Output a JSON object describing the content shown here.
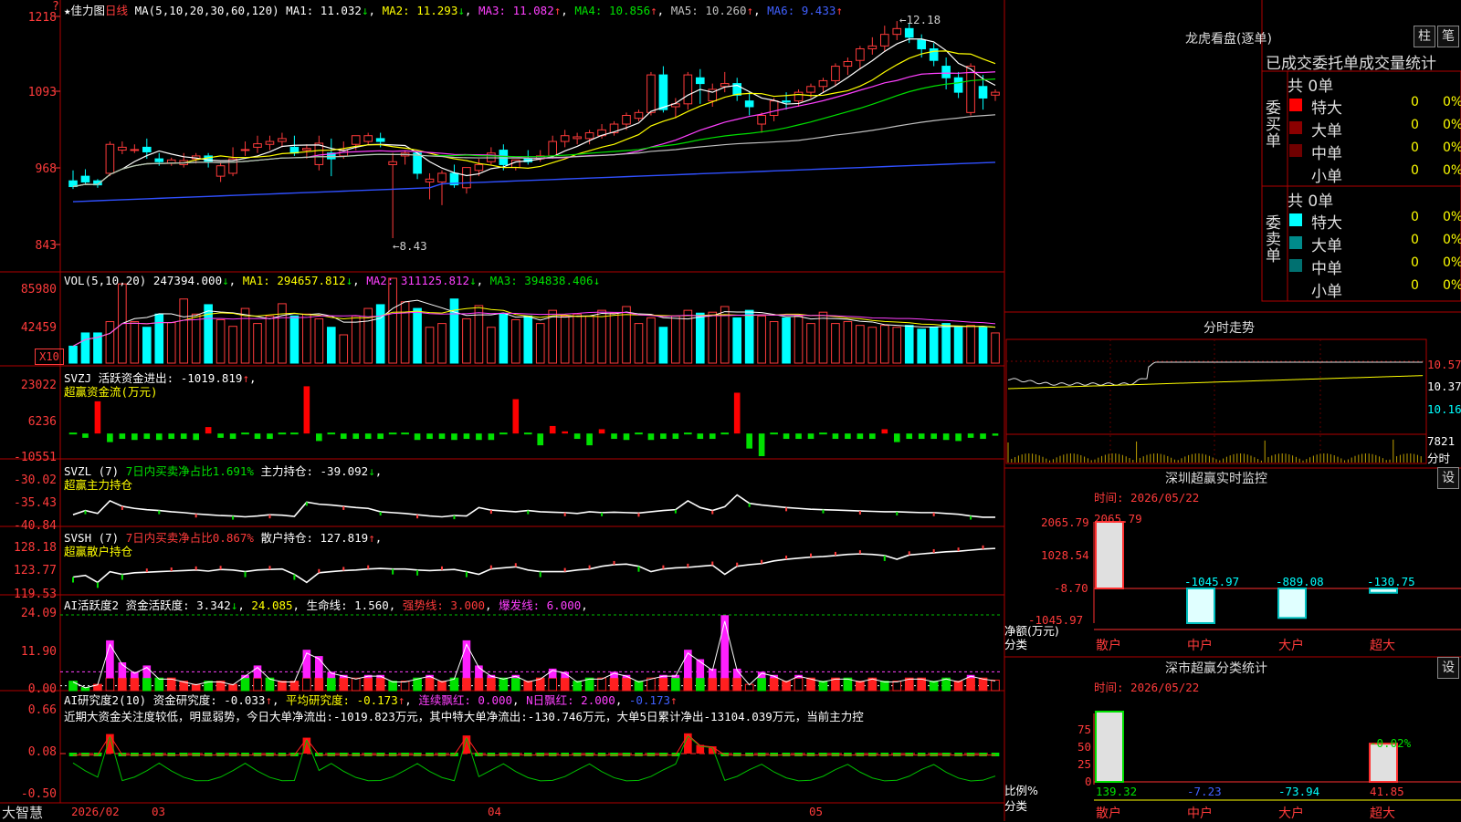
{
  "app": {
    "brand": "大智慧",
    "star": "★",
    "stock_name": "佳力图",
    "period": "日线",
    "corner": "?"
  },
  "main_header": {
    "ma_label": "MA(5,10,20,30,60,120)",
    "ma1": "MA1: 11.032",
    "ma1_arrow": "↓",
    "ma2": "MA2: 11.293",
    "ma2_arrow": "↓",
    "ma3": "MA3: 11.082",
    "ma3_arrow": "↑",
    "ma4": "MA4: 10.856",
    "ma4_arrow": "↑",
    "ma5": "MA5: 10.260",
    "ma5_arrow": "↑",
    "ma6": "MA6: 9.433",
    "ma6_arrow": "↑",
    "high_marker": "12.18",
    "low_marker": "8.43"
  },
  "vol_header": {
    "label": "VOL(5,10,20)",
    "value": "247394.000",
    "arrow": "↓",
    "ma1": "MA1: 294657.812",
    "ma1_arrow": "↓",
    "ma2": "MA2: 311125.812",
    "ma2_arrow": "↓",
    "ma3": "MA3: 394838.406",
    "ma3_arrow": "↓",
    "unit": "X10"
  },
  "svzj_header": {
    "label": "SVZJ",
    "text": "活跃资金进出: -1019.819",
    "arrow": "↑",
    "tail": ",",
    "sub": "超赢资金流(万元)"
  },
  "svzl_header": {
    "label": "SVZL (7)",
    "text1": "7日内买卖净占比1.691%",
    "text2": "主力持仓: -39.092",
    "arrow": "↓",
    "tail": ",",
    "sub": "超赢主力持仓"
  },
  "svsh_header": {
    "label": "SVSH (7)",
    "text1": "7日内买卖净占比0.867%",
    "text2": "散户持仓: 127.819",
    "arrow": "↑",
    "tail": ",",
    "sub": "超赢散户持仓"
  },
  "ai_active_header": {
    "label": "AI活跃度2",
    "text": "资金活跃度: 3.342",
    "arrow": "↓",
    "val2": "24.085",
    "life": "生命线: 1.560",
    "strong": "强势线: 3.000",
    "burst": "爆发线: 6.000"
  },
  "ai_research_header": {
    "label": "AI研究度2(10)",
    "text": "资金研究度: -0.033",
    "arrow": "↑",
    "avg": "平均研究度: -0.173",
    "avg_arrow": "↑",
    "red": "连续飘红: 0.000",
    "nred": "N日飘红: 2.000",
    "last": "-0.173",
    "last_arrow": "↑",
    "comment": "近期大资金关注度较低，明显弱势，今日大单净流出:-1019.823万元，其中特大单净流出:-130.746万元，大单5日累计净出-13104.039万元，当前主力控"
  },
  "y_labels": {
    "main": [
      "1218",
      "1093",
      "968",
      "843"
    ],
    "vol": [
      "85980",
      "42459"
    ],
    "svzj": [
      "23022",
      "6236",
      "-10551"
    ],
    "svzl": [
      "-30.02",
      "-35.43",
      "-40.84"
    ],
    "svsh": [
      "128.18",
      "123.77",
      "119.53"
    ],
    "ai_active": [
      "24.09",
      "11.90",
      "0.00"
    ],
    "ai_research": [
      "0.66",
      "0.08",
      "-0.50"
    ]
  },
  "x_axis": [
    "2026/02",
    "03",
    "04",
    "05"
  ],
  "right": {
    "dragon_title": "龙虎看盘(逐单)",
    "btn1": "柱",
    "btn2": "笔",
    "table_title": "已成交委托单成交量统计",
    "buy_side": "委买单",
    "sell_side": "委卖单",
    "buy_total": "共 0单",
    "sell_total": "共 0单",
    "buy_rows": [
      {
        "name": "特大",
        "count": "0",
        "pct": "0%",
        "color": "#ff0000"
      },
      {
        "name": "大单",
        "count": "0",
        "pct": "0%",
        "color": "#8b0000"
      },
      {
        "name": "中单",
        "count": "0",
        "pct": "0%",
        "color": "#700000"
      },
      {
        "name": "小单",
        "count": "0",
        "pct": "0%",
        "color": "#000000"
      }
    ],
    "sell_rows": [
      {
        "name": "特大",
        "count": "0",
        "pct": "0%",
        "color": "#00ffff"
      },
      {
        "name": "大单",
        "count": "0",
        "pct": "0%",
        "color": "#008b8b"
      },
      {
        "name": "中单",
        "count": "0",
        "pct": "0%",
        "color": "#007070"
      },
      {
        "name": "小单",
        "count": "0",
        "pct": "0%",
        "color": "#000000"
      }
    ],
    "intraday_title": "分时走势",
    "intraday_labels": [
      "10.57",
      "10.37",
      "10.16"
    ],
    "intraday_vol": "7821",
    "intraday_unit": "分时",
    "sz_title": "深圳超赢实时监控",
    "sz_btn": "设",
    "sz_time": "时间: 2026/05/22",
    "sz_y": [
      "2065.79",
      "1028.54",
      "-8.70",
      "-1045.97"
    ],
    "sz_unit1": "净额(万元)",
    "sz_unit2": "分类",
    "sz_cats": [
      "散户",
      "中户",
      "大户",
      "超大"
    ],
    "sz_vals": [
      "2065.79",
      "-1045.97",
      "-889.08",
      "-130.75"
    ],
    "sc_title": "深市超赢分类统计",
    "sc_btn": "设",
    "sc_time": "时间: 2026/05/22",
    "sc_y": [
      "75",
      "50",
      "25",
      "0"
    ],
    "sc_unit1": "比例%",
    "sc_unit2": "分类",
    "sc_cats": [
      "散户",
      "中户",
      "大户",
      "超大"
    ],
    "sc_vals": [
      "139.32",
      "-7.23",
      "-73.94",
      "41.85"
    ],
    "sc_top": "-0.02%"
  },
  "chart_data": [
    {
      "type": "candlestick",
      "title": "佳力图 日线",
      "ylim": [
        8.2,
        12.4
      ],
      "candles": [
        [
          9.42,
          9.6,
          9.32,
          9.28
        ],
        [
          9.5,
          9.62,
          9.4,
          9.35
        ],
        [
          9.42,
          9.45,
          9.35,
          9.3
        ],
        [
          9.55,
          10.1,
          10.05,
          9.5
        ],
        [
          9.95,
          10.1,
          10.0,
          9.88
        ],
        [
          9.95,
          10.05,
          9.96,
          9.9
        ],
        [
          10.0,
          10.15,
          9.92,
          9.8
        ],
        [
          9.8,
          9.9,
          9.75,
          9.68
        ],
        [
          9.72,
          9.82,
          9.78,
          9.68
        ],
        [
          9.7,
          9.9,
          9.77,
          9.65
        ],
        [
          9.8,
          9.9,
          9.85,
          9.72
        ],
        [
          9.85,
          9.9,
          9.75,
          9.65
        ],
        [
          9.5,
          9.75,
          9.68,
          9.4
        ],
        [
          9.55,
          10.0,
          9.8,
          9.5
        ],
        [
          9.95,
          10.1,
          9.96,
          9.85
        ],
        [
          10.0,
          10.2,
          10.06,
          9.9
        ],
        [
          10.05,
          10.2,
          10.1,
          9.95
        ],
        [
          10.1,
          10.25,
          10.15,
          10.0
        ],
        [
          10.0,
          10.2,
          9.9,
          9.85
        ],
        [
          9.95,
          10.05,
          9.98,
          9.8
        ],
        [
          9.7,
          10.2,
          10.07,
          9.6
        ],
        [
          9.9,
          10.15,
          9.8,
          9.5
        ],
        [
          9.85,
          10.1,
          9.95,
          9.8
        ],
        [
          10.05,
          10.2,
          10.2,
          9.95
        ],
        [
          10.1,
          10.25,
          10.2,
          10.05
        ],
        [
          10.15,
          10.25,
          10.1,
          10.0
        ],
        [
          9.7,
          9.9,
          9.75,
          8.43
        ],
        [
          9.85,
          9.95,
          9.9,
          9.7
        ],
        [
          9.9,
          9.92,
          9.55,
          9.45
        ],
        [
          9.4,
          9.55,
          9.45,
          9.1
        ],
        [
          9.4,
          9.6,
          9.55,
          9.0
        ],
        [
          9.55,
          9.7,
          9.35,
          9.3
        ],
        [
          9.3,
          9.5,
          9.65,
          9.2
        ],
        [
          9.6,
          9.8,
          9.7,
          9.5
        ],
        [
          9.75,
          10.0,
          9.9,
          9.7
        ],
        [
          9.95,
          10.05,
          9.7,
          9.6
        ],
        [
          9.65,
          9.75,
          9.78,
          9.6
        ],
        [
          9.8,
          9.95,
          9.75,
          9.7
        ],
        [
          9.8,
          9.95,
          9.85,
          9.75
        ],
        [
          9.85,
          10.2,
          10.1,
          9.8
        ],
        [
          10.1,
          10.3,
          10.2,
          10.0
        ],
        [
          10.15,
          10.25,
          10.18,
          10.05
        ],
        [
          10.15,
          10.3,
          10.25,
          10.05
        ],
        [
          10.2,
          10.4,
          10.3,
          10.15
        ],
        [
          10.25,
          10.45,
          10.4,
          10.2
        ],
        [
          10.4,
          10.6,
          10.55,
          10.3
        ],
        [
          10.5,
          10.65,
          10.6,
          10.45
        ],
        [
          10.6,
          11.3,
          11.25,
          10.55
        ],
        [
          11.25,
          11.4,
          10.65,
          10.6
        ],
        [
          10.7,
          10.85,
          10.75,
          10.5
        ],
        [
          10.75,
          11.3,
          11.25,
          10.65
        ],
        [
          11.2,
          11.35,
          11.1,
          10.75
        ],
        [
          10.8,
          11.1,
          11.0,
          10.7
        ],
        [
          11.05,
          11.3,
          11.1,
          10.95
        ],
        [
          11.1,
          11.2,
          10.9,
          10.8
        ],
        [
          10.8,
          10.95,
          10.7,
          10.55
        ],
        [
          10.4,
          10.6,
          10.55,
          10.25
        ],
        [
          10.55,
          10.85,
          10.8,
          10.45
        ],
        [
          10.8,
          10.95,
          10.78,
          10.65
        ],
        [
          10.8,
          11.0,
          10.95,
          10.7
        ],
        [
          10.95,
          11.1,
          11.05,
          10.85
        ],
        [
          11.05,
          11.2,
          11.15,
          10.95
        ],
        [
          11.15,
          11.45,
          11.4,
          11.05
        ],
        [
          11.4,
          11.55,
          11.48,
          11.25
        ],
        [
          11.5,
          11.75,
          11.7,
          11.35
        ],
        [
          11.7,
          11.9,
          11.75,
          11.6
        ],
        [
          11.75,
          12.1,
          11.95,
          11.65
        ],
        [
          11.95,
          12.18,
          12.05,
          11.85
        ],
        [
          12.05,
          12.15,
          11.9,
          11.8
        ],
        [
          11.85,
          11.95,
          11.7,
          11.55
        ],
        [
          11.7,
          11.8,
          11.5,
          11.4
        ],
        [
          11.4,
          11.55,
          11.2,
          11.0
        ],
        [
          11.2,
          11.3,
          10.95,
          10.85
        ],
        [
          10.6,
          11.45,
          11.4,
          10.55
        ],
        [
          11.05,
          11.25,
          10.85,
          10.65
        ],
        [
          10.9,
          11.0,
          10.95,
          10.8
        ]
      ]
    },
    {
      "type": "bar",
      "title": "VOL(5,10,20)",
      "ylim": [
        0,
        90000
      ],
      "values": [
        18000,
        32000,
        32000,
        44000,
        84000,
        44000,
        38000,
        52000,
        43000,
        68000,
        52000,
        62000,
        46000,
        39000,
        58000,
        42000,
        50000,
        63000,
        50000,
        52000,
        47000,
        38000,
        30000,
        50000,
        58000,
        62000,
        90000,
        65000,
        58000,
        38000,
        42000,
        68000,
        47000,
        61000,
        38000,
        52000,
        46000,
        50000,
        42000,
        56000,
        50000,
        52000,
        50000,
        56000,
        53000,
        60000,
        42000,
        48000,
        38000,
        50000,
        56000,
        53000,
        54000,
        60000,
        48000,
        56000,
        50000,
        44000,
        48000,
        50000,
        42000,
        54000,
        42000,
        44000,
        40000,
        38000,
        40000,
        38000,
        40000,
        36000,
        38000,
        42000,
        38000,
        40000,
        38000,
        32000
      ],
      "up_color": "#ff3b3b",
      "down_color": "#00ffff"
    },
    {
      "type": "bar",
      "title": "SVZJ 活跃资金进出 (万元)",
      "ylim": [
        -10551,
        23022
      ],
      "values": [
        0,
        -2000,
        15000,
        -4000,
        -2500,
        -3000,
        -2500,
        -3000,
        -2500,
        -2500,
        -3000,
        3000,
        -2000,
        -2500,
        0,
        -2500,
        -2500,
        0,
        0,
        22000,
        -3500,
        0,
        -2500,
        -2500,
        -2500,
        -2500,
        0,
        0,
        -3000,
        -2500,
        -2500,
        -3000,
        -2500,
        -3000,
        -3000,
        0,
        16000,
        0,
        -5500,
        3500,
        1000,
        -2500,
        -5500,
        2000,
        -2500,
        -3000,
        0,
        -3000,
        -2500,
        -2500,
        0,
        -2500,
        -2500,
        0,
        19000,
        -7000,
        -10551,
        0,
        -2500,
        -2500,
        -2500,
        0,
        -2500,
        -2500,
        -2500,
        -2500,
        2000,
        -4000,
        -2500,
        -2500,
        -2500,
        -3000,
        -3500,
        -2000,
        -2500,
        -1019.819
      ]
    },
    {
      "type": "line",
      "title": "SVZL 主力持仓",
      "ylim": [
        -40.84,
        -30.02
      ],
      "values": [
        -38.5,
        -37.5,
        -38.2,
        -35.2,
        -36.5,
        -37.0,
        -37.3,
        -37.5,
        -37.8,
        -38.0,
        -38.3,
        -38.5,
        -38.7,
        -38.8,
        -39.0,
        -38.8,
        -38.5,
        -38.6,
        -38.9,
        -35.5,
        -36.0,
        -36.2,
        -36.5,
        -36.8,
        -37.0,
        -37.8,
        -38.0,
        -38.2,
        -38.5,
        -38.8,
        -39.0,
        -38.7,
        -38.8,
        -36.8,
        -37.4,
        -37.6,
        -37.8,
        -37.5,
        -37.8,
        -37.9,
        -38.0,
        -38.2,
        -37.8,
        -38.0,
        -37.9,
        -38.0,
        -38.1,
        -37.8,
        -37.5,
        -37.3,
        -35.2,
        -36.8,
        -37.5,
        -36.6,
        -33.8,
        -35.8,
        -36.2,
        -36.5,
        -36.8,
        -37.0,
        -37.2,
        -37.3,
        -37.4,
        -37.5,
        -37.6,
        -37.7,
        -37.8,
        -37.8,
        -37.9,
        -38.0,
        -38.0,
        -38.2,
        -38.4,
        -38.8,
        -39.1,
        -39.09
      ]
    },
    {
      "type": "line",
      "title": "SVSH 散户持仓",
      "ylim": [
        119.53,
        128.18
      ],
      "values": [
        122.5,
        122.8,
        121.5,
        123.5,
        123.0,
        123.3,
        123.4,
        123.5,
        123.6,
        123.7,
        123.8,
        123.6,
        123.9,
        123.8,
        123.5,
        123.8,
        123.9,
        124.0,
        123.0,
        121.5,
        123.3,
        123.5,
        123.7,
        123.8,
        124.0,
        124.1,
        124.0,
        124.0,
        123.8,
        123.7,
        123.8,
        123.9,
        123.5,
        123.0,
        124.0,
        124.2,
        124.4,
        123.8,
        123.5,
        123.5,
        123.5,
        123.8,
        124.0,
        124.5,
        124.8,
        124.9,
        124.5,
        123.5,
        124.0,
        124.2,
        124.3,
        124.5,
        124.7,
        123.0,
        124.5,
        124.8,
        125.0,
        125.5,
        125.8,
        126.0,
        126.2,
        126.3,
        126.5,
        126.7,
        126.8,
        126.7,
        126.5,
        125.8,
        126.6,
        126.8,
        127.0,
        127.2,
        127.3,
        127.5,
        127.7,
        127.82
      ]
    },
    {
      "type": "bar",
      "title": "AI活跃度2 资金活跃度",
      "ylim": [
        0,
        24.09
      ],
      "values": [
        3,
        1,
        2,
        16,
        9,
        6,
        8,
        4,
        4,
        3,
        2,
        3,
        3,
        2,
        5,
        8,
        4,
        3,
        3,
        13,
        11,
        6,
        5,
        4,
        5,
        5,
        3,
        3,
        4,
        5,
        3,
        4,
        16,
        8,
        5,
        4,
        5,
        3,
        4,
        7,
        6,
        3,
        4,
        4,
        6,
        5,
        3,
        4,
        5,
        5,
        13,
        10,
        7,
        24,
        7,
        2,
        6,
        5,
        3,
        5,
        4,
        3,
        4,
        4,
        3,
        4,
        3,
        3,
        4,
        4,
        3,
        4,
        3,
        5,
        4,
        3.342
      ]
    },
    {
      "type": "bar",
      "title": "AI研究度2(10) 资金研究度",
      "ylim": [
        -0.5,
        0.66
      ],
      "values": [
        0.05,
        0.04,
        0.04,
        0.35,
        0.08,
        0.06,
        0.06,
        0.05,
        0.05,
        0.04,
        0.04,
        0.05,
        0.08,
        0.06,
        0.06,
        0.06,
        0.08,
        0.08,
        0.06,
        0.3,
        0.05,
        0.04,
        0.04,
        0.04,
        0.04,
        0.05,
        0.06,
        0.04,
        0.04,
        0.04,
        0.04,
        0.05,
        0.33,
        0.1,
        0.06,
        0.06,
        0.05,
        0.05,
        0.05,
        0.05,
        0.05,
        0.05,
        0.06,
        0.05,
        0.05,
        0.06,
        0.06,
        0.05,
        0.05,
        0.05,
        0.36,
        0.2,
        0.18,
        0.06,
        0.05,
        0.05,
        0.05,
        0.05,
        0.04,
        0.04,
        0.04,
        0.04,
        0.04,
        0.04,
        0.04,
        0.04,
        0.04,
        0.04,
        0.04,
        0.04,
        0.04,
        0.04,
        0.04,
        0.04,
        0.04,
        -0.033
      ]
    }
  ]
}
